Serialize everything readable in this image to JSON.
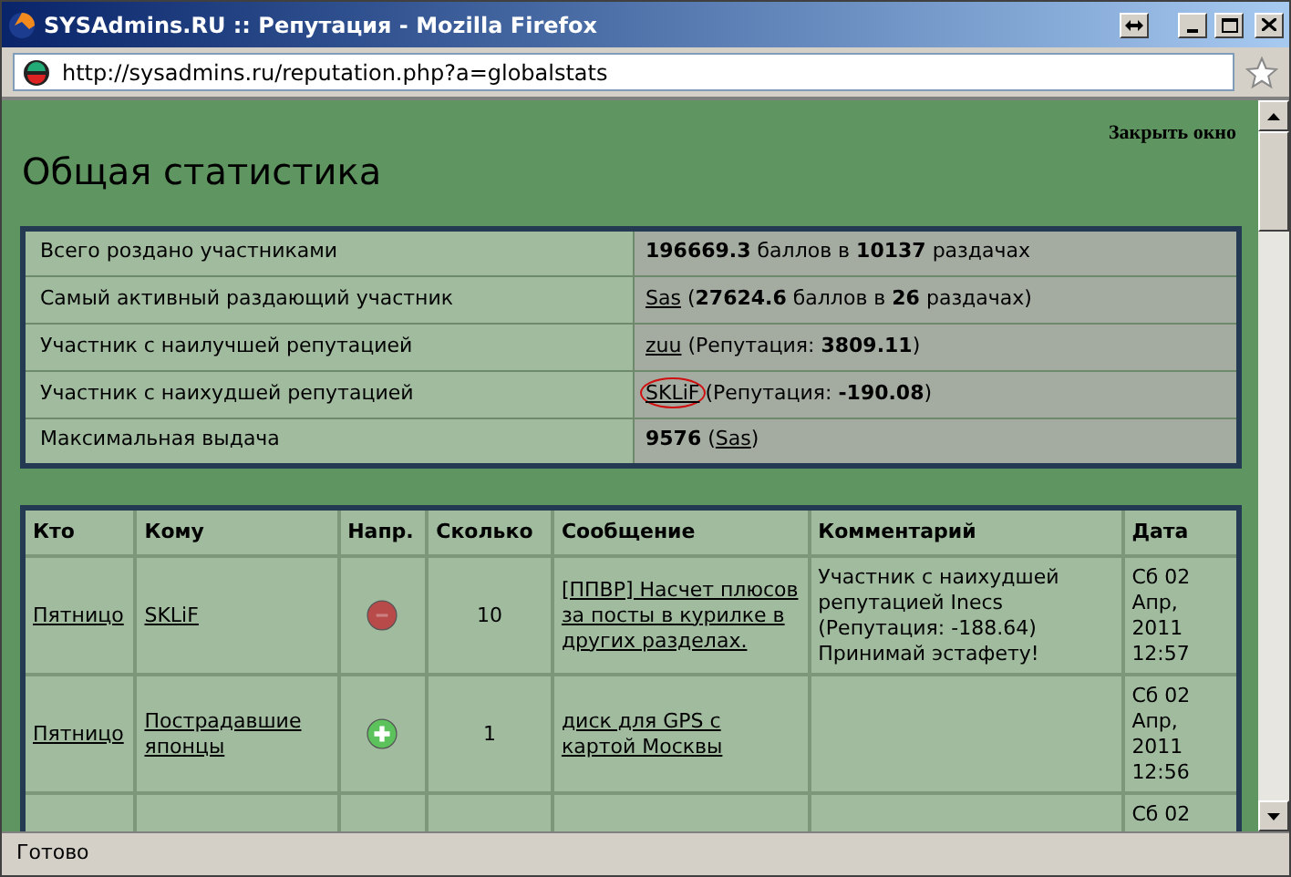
{
  "window": {
    "title": "SYSAdmins.RU :: Репутация - Mozilla Firefox"
  },
  "address_bar": {
    "url": "http://sysadmins.ru/reputation.php?a=globalstats"
  },
  "close_link": "Закрыть окно",
  "heading": "Общая статистика",
  "stats": [
    {
      "label": "Всего роздано участниками",
      "text": "**196669.3** баллов в **10137** раздачах",
      "circled": false
    },
    {
      "label": "Самый активный раздающий участник",
      "link": "Sas",
      "text": " (**27624.6** баллов в **26** раздачах)",
      "circled": false
    },
    {
      "label": "Участник с наилучшей репутацией",
      "link": "zuu",
      "text": " (Репутация: **3809.11**)",
      "circled": false
    },
    {
      "label": "Участник с наихудшей репутацией",
      "link": "SKLiF",
      "text": "(Репутация: **-190.08**)",
      "circled": true
    },
    {
      "label": "Максимальная выдача",
      "text": "**9576** (",
      "link": "Sas",
      "text_after": ")",
      "circled": false
    }
  ],
  "table": {
    "columns": [
      "Кто",
      "Кому",
      "Напр.",
      "Сколько",
      "Сообщение",
      "Комментарий",
      "Дата"
    ],
    "rows": [
      {
        "from": "Пятницо",
        "to": "SKLiF",
        "positive": false,
        "amount": "10",
        "message": "[ППВР] Насчет плюсов за посты в курилке в других разделах.",
        "comment": "Участник с наихудшей репутацией Inecs (Репутация: -188.64) Принимай эстафету!",
        "date": "Сб 02 Апр, 2011 12:57"
      },
      {
        "from": "Пятницо",
        "to": "Пострадавшие японцы",
        "positive": true,
        "amount": "1",
        "message": "диск для GPS с картой Москвы",
        "date": "Сб 02 Апр, 2011 12:56"
      },
      {
        "date": "Сб 02"
      }
    ]
  },
  "status_bar": {
    "text": "Готово"
  }
}
